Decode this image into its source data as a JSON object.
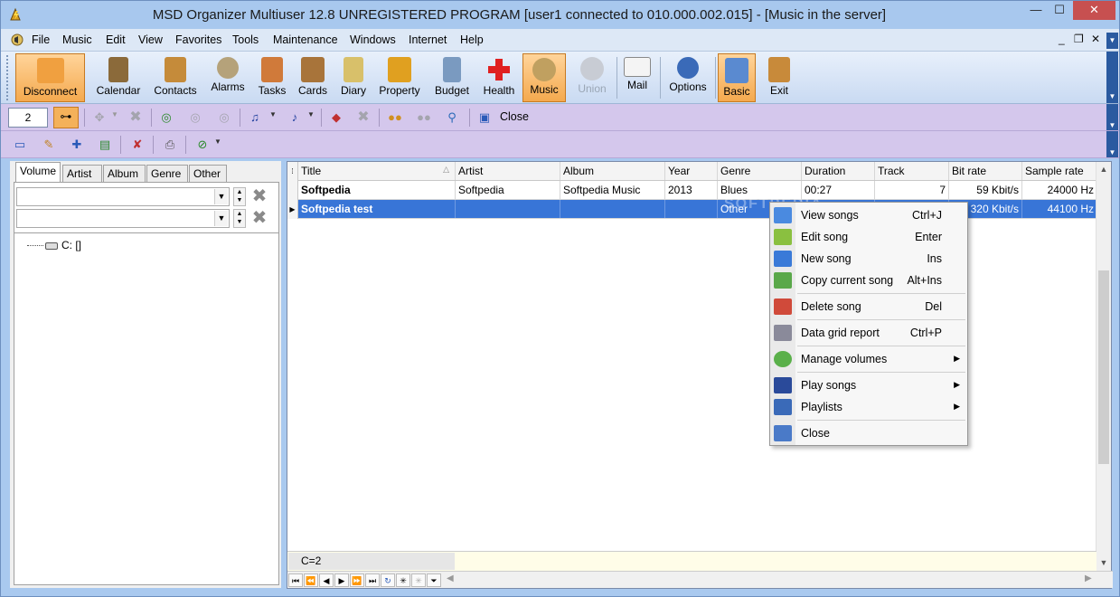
{
  "window": {
    "title": "MSD Organizer Multiuser 12.8 UNREGISTERED PROGRAM [user1 connected to 010.000.002.015] - [Music in the server]",
    "min_glyph": "—",
    "max_glyph": "☐",
    "close_glyph": "✕"
  },
  "menubar": {
    "items": [
      "File",
      "Music",
      "Edit",
      "View",
      "Favorites",
      "Tools",
      "Maintenance",
      "Windows",
      "Internet",
      "Help"
    ],
    "mdi_min": "_",
    "mdi_restore": "❐",
    "mdi_close": "✕"
  },
  "toolbar_main": {
    "buttons": [
      {
        "label": "Disconnect",
        "icon": "disconnect-icon",
        "color": "#f0a040"
      },
      {
        "label": "Calendar",
        "icon": "calendar-icon",
        "color": "#8b6a3a"
      },
      {
        "label": "Contacts",
        "icon": "contacts-icon",
        "color": "#c58b3a"
      },
      {
        "label": "Alarms",
        "icon": "alarm-clock-icon",
        "color": "#b5a27a"
      },
      {
        "label": "Tasks",
        "icon": "tasks-icon",
        "color": "#d07a3a"
      },
      {
        "label": "Cards",
        "icon": "cards-icon",
        "color": "#a8743a"
      },
      {
        "label": "Diary",
        "icon": "diary-icon",
        "color": "#d8c06a"
      },
      {
        "label": "Property",
        "icon": "house-icon",
        "color": "#e0a020"
      },
      {
        "label": "Budget",
        "icon": "calculator-icon",
        "color": "#7a9ac0"
      },
      {
        "label": "Health",
        "icon": "health-cross-icon",
        "color": "#e02020"
      },
      {
        "label": "Music",
        "icon": "music-cd-icon",
        "color": "#c0a060"
      },
      {
        "label": "Union",
        "icon": "union-gear-icon",
        "color": "#c8ccd4"
      },
      {
        "label": "Mail",
        "icon": "mail-envelope-icon",
        "color": "#f4f4f4"
      },
      {
        "label": "Options",
        "icon": "options-gear-icon",
        "color": "#3a6ab8"
      },
      {
        "label": "Basic",
        "icon": "basic-window-icon",
        "color": "#5a8ad0"
      },
      {
        "label": "Exit",
        "icon": "exit-door-icon",
        "color": "#c88a3a"
      }
    ]
  },
  "toolbar_second": {
    "counter_value": "2",
    "close_label": "Close"
  },
  "left_panel": {
    "tabs": [
      "Volume",
      "Artist",
      "Album",
      "Genre",
      "Other"
    ],
    "tree_root": "C: []"
  },
  "grid": {
    "columns": [
      "Title",
      "Artist",
      "Album",
      "Year",
      "Genre",
      "Duration",
      "Track",
      "Bit rate",
      "Sample rate"
    ],
    "rows": [
      {
        "title": "Softpedia",
        "artist": "Softpedia",
        "album": "Softpedia Music",
        "year": "2013",
        "genre": "Blues",
        "duration": "00:27",
        "track": "7",
        "bitrate": "59 Kbit/s",
        "samplerate": "24000 Hz"
      },
      {
        "title": "Softpedia test",
        "artist": "",
        "album": "",
        "year": "",
        "genre": "Other",
        "duration": "",
        "track": "",
        "bitrate": "320 Kbit/s",
        "samplerate": "44100 Hz"
      }
    ],
    "count_label": "C=2"
  },
  "context_menu": {
    "items": [
      {
        "label": "View songs",
        "shortcut": "Ctrl+J",
        "icon": "monitor-icon"
      },
      {
        "label": "Edit song",
        "shortcut": "Enter",
        "icon": "edit-pencil-icon"
      },
      {
        "label": "New song",
        "shortcut": "Ins",
        "icon": "new-plus-icon"
      },
      {
        "label": "Copy current song",
        "shortcut": "Alt+Ins",
        "icon": "copy-icon"
      },
      {
        "label": "Delete song",
        "shortcut": "Del",
        "icon": "delete-x-icon"
      },
      {
        "label": "Data grid report",
        "shortcut": "Ctrl+P",
        "icon": "printer-icon"
      },
      {
        "label": "Manage volumes",
        "shortcut": "",
        "icon": "cd-volume-icon"
      },
      {
        "label": "Play songs",
        "shortcut": "",
        "icon": "speaker-note-icon"
      },
      {
        "label": "Playlists",
        "shortcut": "",
        "icon": "playlist-note-icon"
      },
      {
        "label": "Close",
        "shortcut": "",
        "icon": "close-window-icon"
      }
    ]
  },
  "watermark": "SOFTPEDIA"
}
